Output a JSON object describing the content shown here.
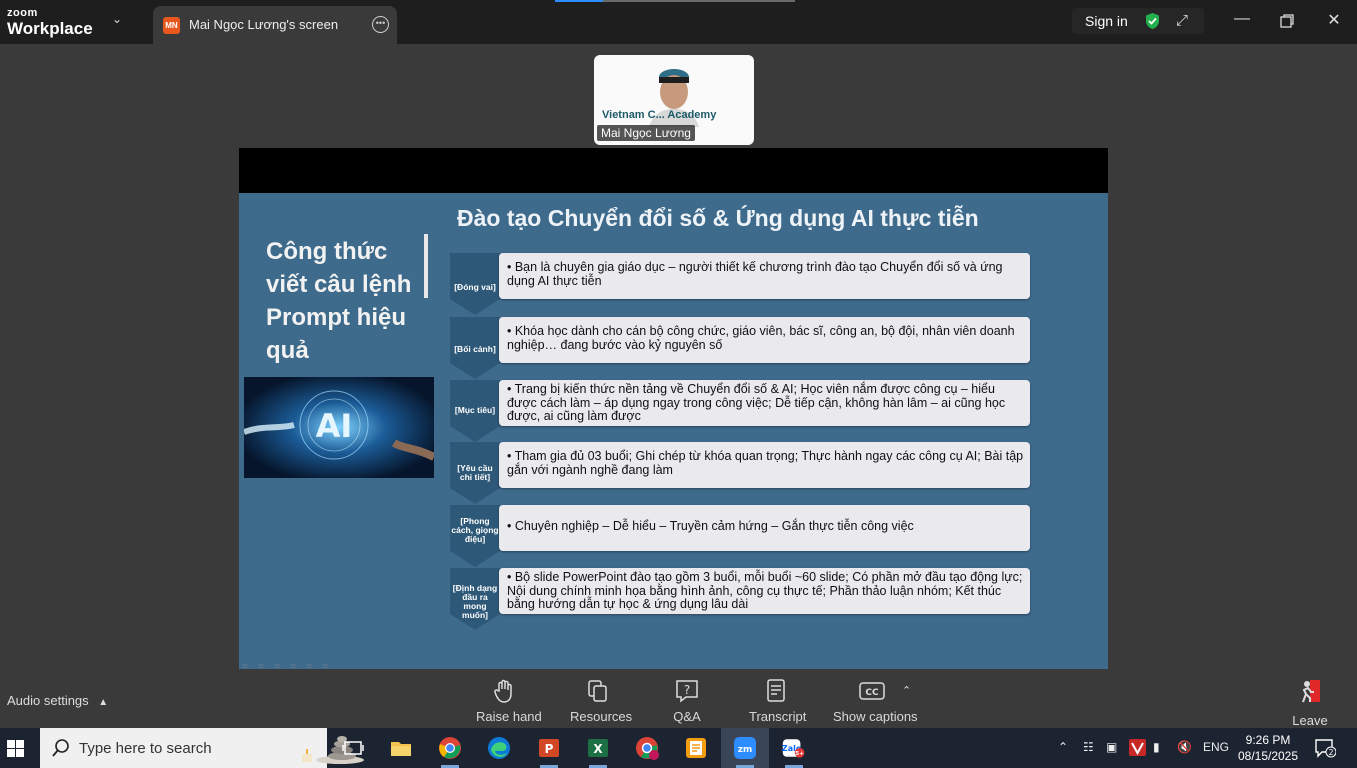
{
  "app": {
    "brand_small": "zoom",
    "brand_large": "Workplace"
  },
  "tab": {
    "avatar_initials": "MN",
    "title": "Mai Ngọc Lương's screen"
  },
  "topbar": {
    "signin_label": "Sign in"
  },
  "video": {
    "participant_name": "Mai Ngọc Lương",
    "banner_text": "Vietnam C... Academy"
  },
  "slide": {
    "title": "Đào tạo Chuyển đổi số & Ứng dụng AI thực tiễn",
    "side_heading": "Công thức viết câu lệnh Prompt hiệu quả",
    "image_label": "AI",
    "items": [
      {
        "tag": "[Đóng vai]",
        "text": "• Bạn là chuyên gia giáo dục – người thiết kế chương trình đào tạo Chuyển đổi số và ứng dụng AI thực tiễn"
      },
      {
        "tag": "[Bối cảnh]",
        "text": "• Khóa học dành cho cán bộ công chức, giáo viên, bác sĩ, công an, bộ đội, nhân viên doanh nghiệp… đang bước vào kỷ nguyên số"
      },
      {
        "tag": "[Mục tiêu]",
        "text": "• Trang bị kiến thức nền tảng về Chuyển đổi số & AI; Học viên nắm được công cụ – hiểu được cách làm – áp dụng ngay trong công việc; Dễ tiếp cận, không hàn lâm – ai cũng học được, ai cũng làm được"
      },
      {
        "tag": "[Yêu cầu chi tiết]",
        "text": "• Tham gia đủ 03 buổi; Ghi chép từ khóa quan trọng; Thực hành ngay các công cụ AI; Bài tập gắn với ngành nghề đang làm"
      },
      {
        "tag": "[Phong cách, giọng điệu]",
        "text": "• Chuyên nghiệp – Dễ hiểu – Truyền cảm hứng – Gắn thực tiễn công việc"
      },
      {
        "tag": "[Định dạng đầu ra mong muốn]",
        "text": "• Bộ slide PowerPoint đào tạo gồm 3 buổi, mỗi buổi ~60 slide; Có phần mở đầu tạo động lực; Nội dung chính minh họa bằng hình ảnh, công cụ thực tế; Phần thảo luận nhóm; Kết thúc bằng hướng dẫn tự học & ứng dụng lâu dài"
      }
    ]
  },
  "controls": {
    "audio_settings": "Audio settings",
    "raise_hand": "Raise hand",
    "resources": "Resources",
    "qa": "Q&A",
    "transcript": "Transcript",
    "show_captions": "Show captions",
    "leave": "Leave"
  },
  "taskbar": {
    "search_placeholder": "Type here to search",
    "language": "ENG",
    "time": "9:26 PM",
    "date": "08/15/2025",
    "notification_count": "2",
    "zalo_badge": "5+"
  },
  "colors": {
    "accent": "#2d8cff",
    "slide_bg": "#3e6a8c",
    "tag_arrow": "#2e5878",
    "leave_red": "#e02828"
  }
}
